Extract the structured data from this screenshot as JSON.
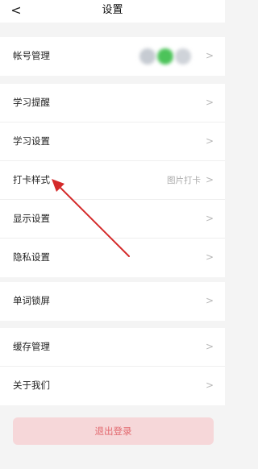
{
  "header": {
    "title": "设置",
    "back_glyph": "<",
    "back_icon": "chevron-left-icon"
  },
  "chevron_glyph": ">",
  "account_group": {
    "label": "帐号管理"
  },
  "settings_group": {
    "items": [
      {
        "label": "学习提醒",
        "value": ""
      },
      {
        "label": "学习设置",
        "value": ""
      },
      {
        "label": "打卡样式",
        "value": "图片打卡"
      },
      {
        "label": "显示设置",
        "value": ""
      },
      {
        "label": "隐私设置",
        "value": ""
      }
    ]
  },
  "lock_group": {
    "label": "单词锁屏"
  },
  "misc_group": {
    "items": [
      {
        "label": "缓存管理"
      },
      {
        "label": "关于我们"
      }
    ]
  },
  "logout": {
    "label": "退出登录"
  },
  "colors": {
    "logout_bg": "#f6d7d9",
    "logout_text": "#e2696f",
    "annotation_arrow": "#d42a2a"
  }
}
